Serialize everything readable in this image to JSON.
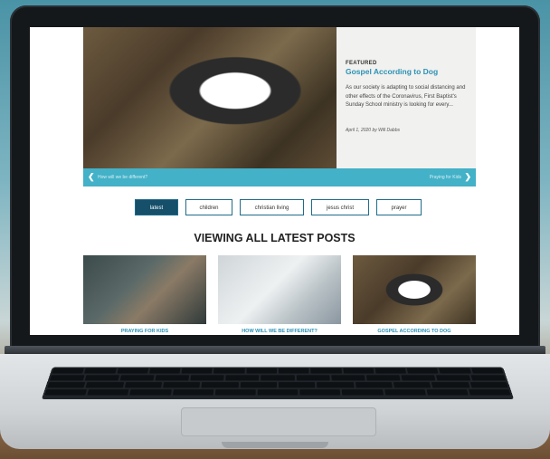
{
  "featured": {
    "label": "FEATURED",
    "title": "Gospel According to Dog",
    "excerpt": "As our society is adapting to social distancing and other effects of the Coronavirus, First Baptist's Sunday School ministry is looking for every...",
    "meta": "April 1, 2020 by Will Dabbs"
  },
  "slider": {
    "prev_label": "How will we be different?",
    "next_label": "Praying for Kids"
  },
  "tags": [
    "latest",
    "children",
    "christian living",
    "jesus christ",
    "prayer"
  ],
  "section_title": "VIEWING ALL LATEST POSTS",
  "posts": [
    {
      "title": "PRAYING FOR KIDS"
    },
    {
      "title": "HOW WILL WE BE DIFFERENT?"
    },
    {
      "title": "GOSPEL ACCORDING TO DOG"
    }
  ],
  "colors": {
    "accent": "#43b1c7",
    "link": "#2b91b5",
    "active_tag": "#154f6a"
  }
}
